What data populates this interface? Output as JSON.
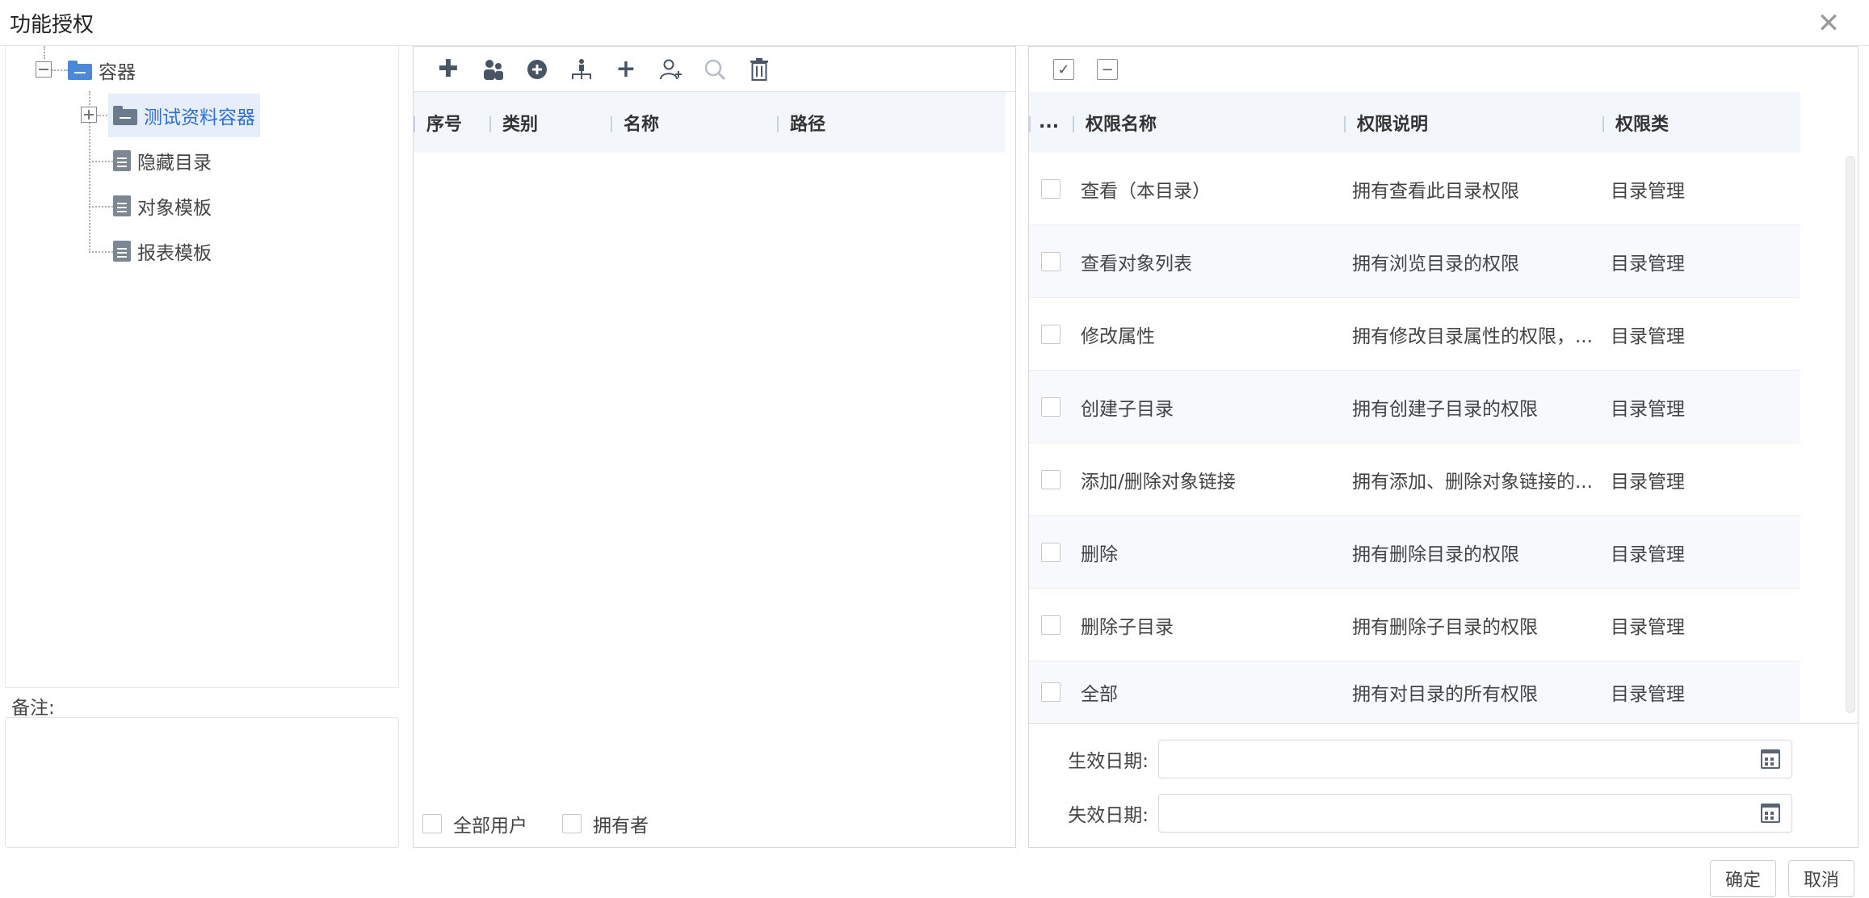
{
  "dialog": {
    "title": "功能授权",
    "close_glyph": "✕"
  },
  "tree": {
    "root": {
      "label": "容器",
      "icon": "folder-open-icon"
    },
    "container": {
      "label": "测试资料容器",
      "icon": "folder-icon",
      "selected": true
    },
    "children": [
      {
        "label": "隐藏目录",
        "icon": "document-icon"
      },
      {
        "label": "对象模板",
        "icon": "document-icon"
      },
      {
        "label": "报表模板",
        "icon": "document-icon"
      }
    ]
  },
  "remark": {
    "label": "备注:"
  },
  "members": {
    "toolbar": [
      {
        "name": "add-icon",
        "glyph": "✚"
      },
      {
        "name": "users-icon",
        "glyph": "👥"
      },
      {
        "name": "circle-add-icon",
        "glyph": "⊕"
      },
      {
        "name": "org-icon",
        "glyph": "♙"
      },
      {
        "name": "plus-icon",
        "glyph": "+"
      },
      {
        "name": "add-user-icon",
        "glyph": "⚇"
      },
      {
        "name": "search-icon",
        "glyph": "⌕"
      },
      {
        "name": "trash-icon",
        "glyph": "🗑"
      }
    ],
    "columns": [
      "序号",
      "类别",
      "名称",
      "路径"
    ],
    "footer": {
      "all_users": "全部用户",
      "owner": "拥有者"
    }
  },
  "permissions": {
    "columns": [
      "...",
      "权限名称",
      "权限说明",
      "权限类"
    ],
    "rows": [
      {
        "name": "查看（本目录）",
        "desc": "拥有查看此目录权限",
        "type": "目录管理"
      },
      {
        "name": "查看对象列表",
        "desc": "拥有浏览目录的权限",
        "type": "目录管理"
      },
      {
        "name": "修改属性",
        "desc": "拥有修改目录属性的权限，...",
        "type": "目录管理"
      },
      {
        "name": "创建子目录",
        "desc": "拥有创建子目录的权限",
        "type": "目录管理"
      },
      {
        "name": "添加/删除对象链接",
        "desc": "拥有添加、删除对象链接的...",
        "type": "目录管理"
      },
      {
        "name": "删除",
        "desc": "拥有删除目录的权限",
        "type": "目录管理"
      },
      {
        "name": "删除子目录",
        "desc": "拥有删除子目录的权限",
        "type": "目录管理"
      },
      {
        "name": "全部",
        "desc": "拥有对目录的所有权限",
        "type": "目录管理"
      }
    ],
    "effective_date_label": "生效日期:",
    "expire_date_label": "失效日期:"
  },
  "buttons": {
    "ok": "确定",
    "cancel": "取消"
  },
  "colors": {
    "accent": "#2f6fcf",
    "selected_bg": "#e6eefa",
    "header_bg": "#f3f6fa"
  }
}
